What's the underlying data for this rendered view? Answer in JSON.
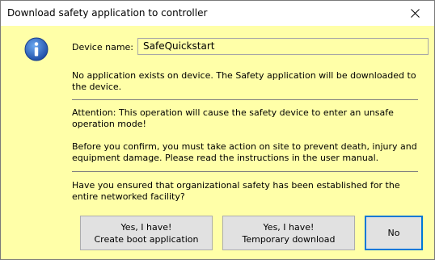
{
  "window": {
    "title": "Download safety application to controller",
    "close_icon": "close-icon"
  },
  "info_icon": "info-icon",
  "device": {
    "label": "Device name:",
    "value": "SafeQuickstart"
  },
  "messages": {
    "no_application": "No application exists on device. The Safety application will be downloaded to the device.",
    "attention": "Attention: This operation will cause the safety device to enter an unsafe operation mode!",
    "before_confirm": "Before you confirm, you must take action on site to prevent death, injury and equipment damage. Please read the instructions in the user manual.",
    "question": "Have you ensured that organizational safety has been established for the entire networked facility?"
  },
  "buttons": {
    "boot": {
      "line1": "Yes, I have!",
      "line2": "Create boot application"
    },
    "temporary": {
      "line1": "Yes, I have!",
      "line2": "Temporary download"
    },
    "no": {
      "label": "No"
    }
  },
  "colors": {
    "dialog_background": "#ffffa8",
    "focus_border": "#0078d7",
    "info_icon_blue": "#1f5fbf"
  }
}
